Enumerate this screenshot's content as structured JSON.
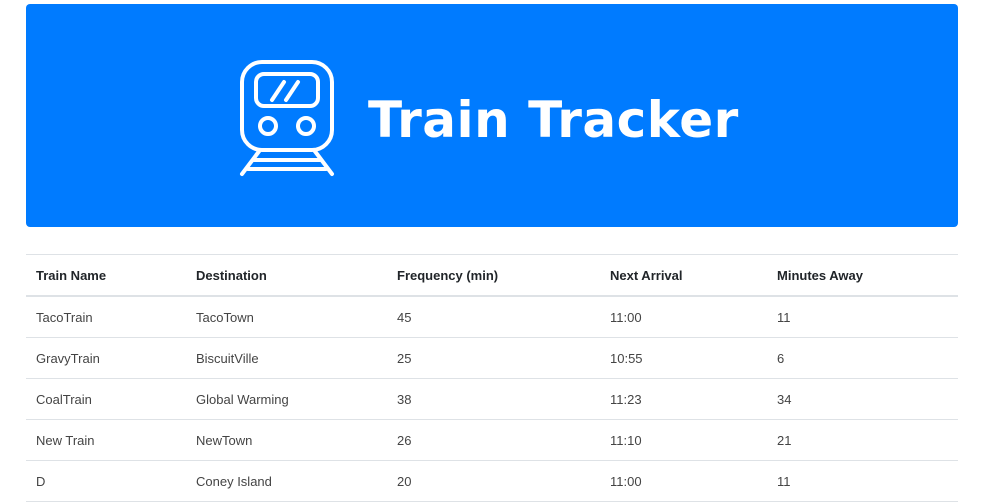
{
  "header": {
    "title": "Train Tracker",
    "icon": "train-icon",
    "background_color": "#007bff"
  },
  "table": {
    "columns": [
      "Train Name",
      "Destination",
      "Frequency (min)",
      "Next Arrival",
      "Minutes Away"
    ],
    "rows": [
      [
        "TacoTrain",
        "TacoTown",
        "45",
        "11:00",
        "11"
      ],
      [
        "GravyTrain",
        "BiscuitVille",
        "25",
        "10:55",
        "6"
      ],
      [
        "CoalTrain",
        "Global Warming",
        "38",
        "11:23",
        "34"
      ],
      [
        "New Train",
        "NewTown",
        "26",
        "11:10",
        "21"
      ],
      [
        "D",
        "Coney Island",
        "20",
        "11:00",
        "11"
      ]
    ]
  }
}
